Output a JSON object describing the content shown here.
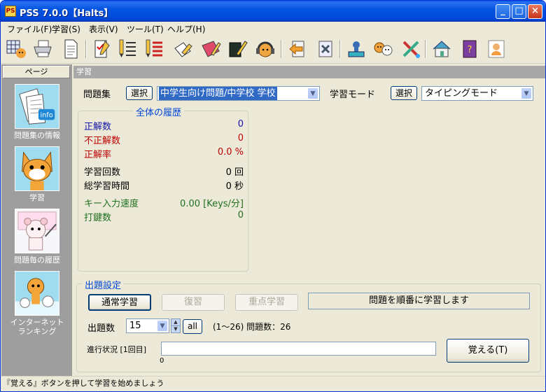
{
  "window": {
    "title": "PSS 7.0.0【Halts】",
    "app_icon_text": "PS"
  },
  "menu": [
    {
      "label": "ファイル(F)"
    },
    {
      "label": "学習(S)"
    },
    {
      "label": "表示(V)"
    },
    {
      "label": "ツール(T)"
    },
    {
      "label": "ヘルプ(H)"
    }
  ],
  "toolbar_icons": [
    "grid-cat-icon",
    "printer-icon",
    "document-icon",
    "checklist-icon",
    "list-pencil-icon",
    "list-red-icon",
    "eraser-icon",
    "notebook-icon",
    "book-pencil-icon",
    "headphone-cat-icon",
    "arrow-left-icon",
    "delete-icon",
    "stamp-icon",
    "cat-dog-icon",
    "tools-icon",
    "house-icon",
    "help-book-icon",
    "person-icon"
  ],
  "sidebar": {
    "header": "ページ",
    "items": [
      {
        "label": "問題集の情報",
        "icon": "info-papers-icon"
      },
      {
        "label": "学習",
        "icon": "cat-character-icon"
      },
      {
        "label": "問題毎の履歴",
        "icon": "bear-teacher-icon"
      },
      {
        "label": "インターネット\nランキング",
        "icon": "ranking-characters-icon"
      }
    ]
  },
  "main": {
    "header": "学習",
    "problem_set_label": "問題集",
    "select_label": "選択",
    "problem_set_value": "中学生向け問題/中学校 学校",
    "mode_label": "学習モード",
    "mode_select_label": "選択",
    "mode_value": "タイピングモード",
    "history": {
      "title": "全体の履歴",
      "rows": [
        {
          "key": "正解数",
          "value": "0",
          "color": "#1515a8"
        },
        {
          "key": "不正解数",
          "value": "0",
          "color": "#c00000"
        },
        {
          "key": "正解率",
          "value": "0.0 %",
          "color": "#c00000"
        },
        {
          "key": "学習回数",
          "value": "0 回",
          "color": "#000000"
        },
        {
          "key": "総学習時間",
          "value": "0 秒",
          "color": "#000000"
        },
        {
          "key": "キー入力速度",
          "value": "0.00 [Keys/分]",
          "color": "#207020"
        },
        {
          "key": "打鍵数",
          "value": "0",
          "color": "#207020"
        }
      ]
    },
    "settings": {
      "title": "出題設定",
      "normal_button": "通常学習",
      "review_button": "復習",
      "focus_button": "重点学習",
      "mode_status": "問題を順番に学習します",
      "count_label": "出題数",
      "count_value": "15",
      "all_button": "all",
      "range_text": "(1〜26) 問題数：26",
      "progress_label": "進行状況 [1回目]",
      "progress_value_text": "0",
      "progress_fraction": 0,
      "memorize_button": "覚える(T)"
    }
  },
  "statusbar": {
    "text": "『覚える』ボタンを押して学習を始めましょう"
  }
}
